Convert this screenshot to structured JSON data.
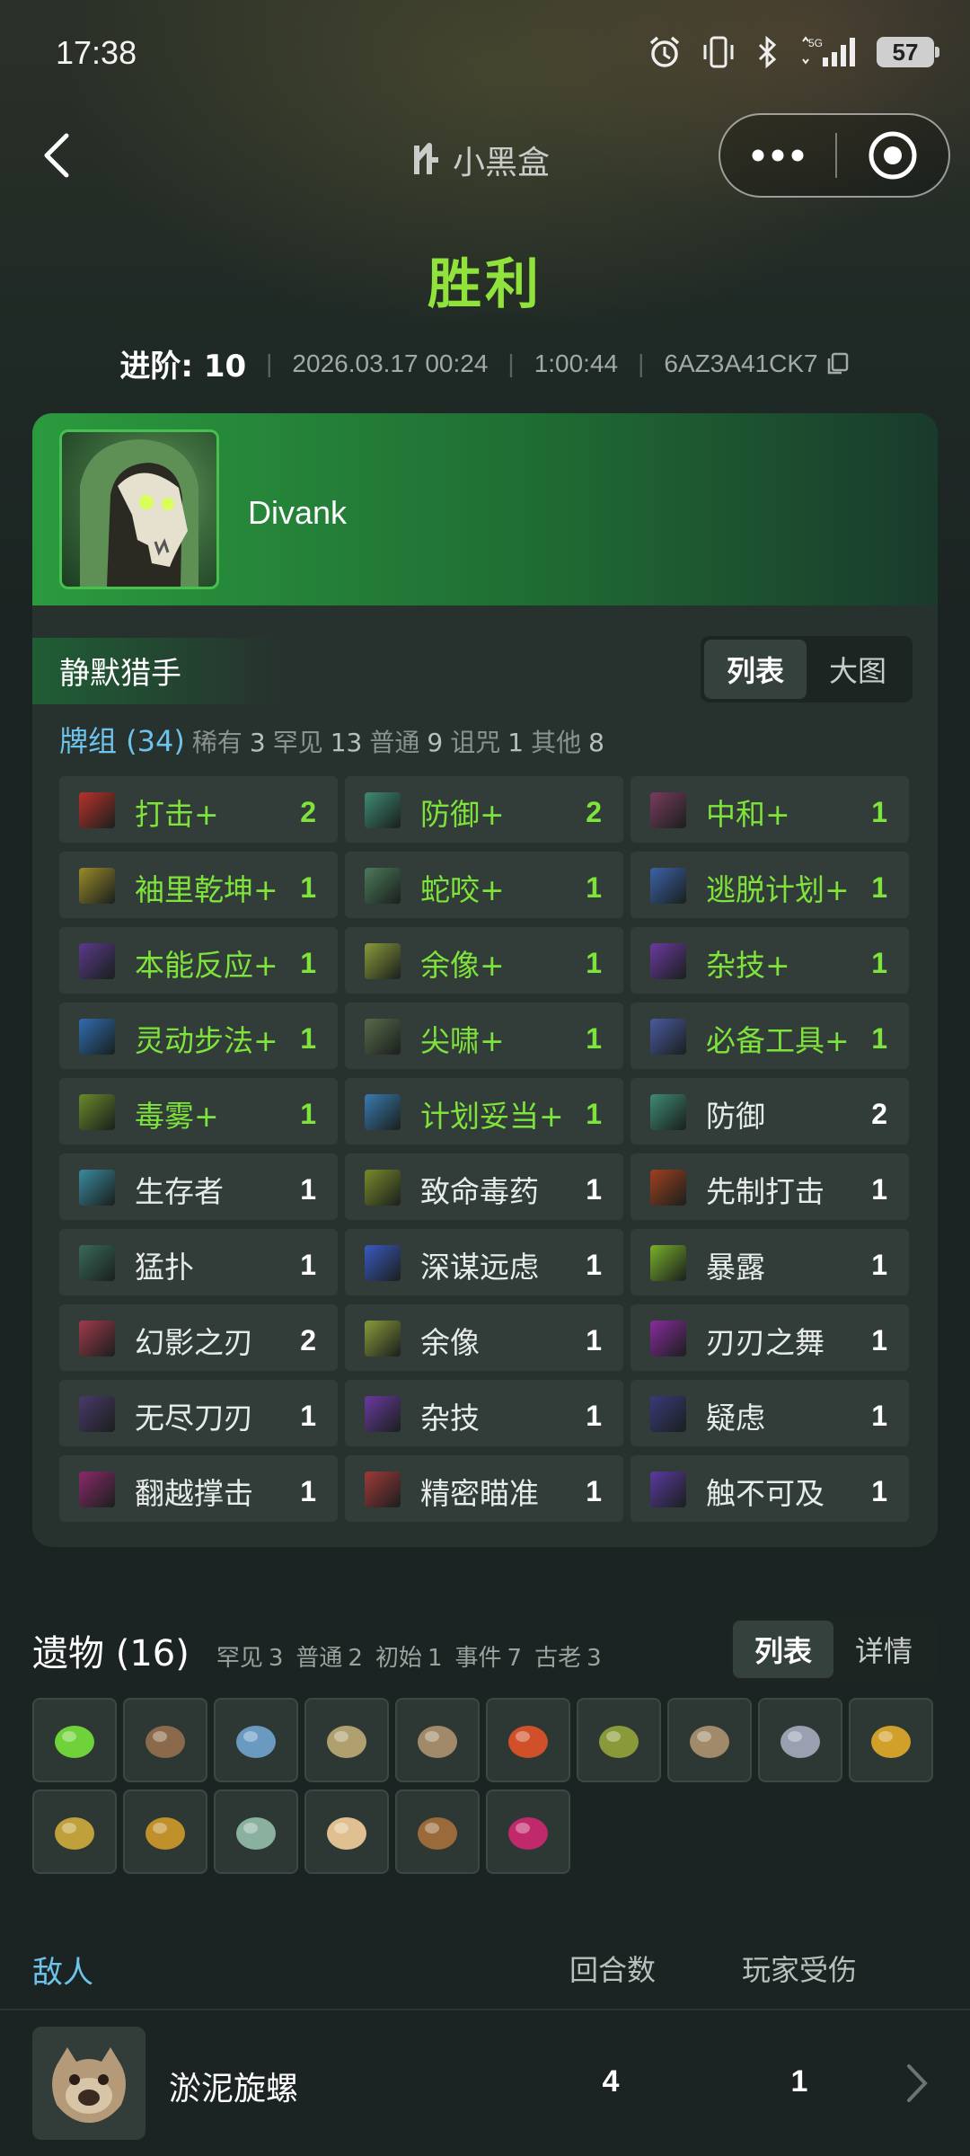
{
  "status_bar": {
    "time": "17:38",
    "battery": "57",
    "network": "5G"
  },
  "nav": {
    "brand": "小黑盒"
  },
  "result": {
    "title": "胜利",
    "ascension": "进阶: 10",
    "datetime": "2026.03.17 00:24",
    "duration": "1:00:44",
    "seed": "6AZ3A41CK7"
  },
  "character": {
    "name": "Divank",
    "class_name": "静默猎手"
  },
  "deck": {
    "view_toggle": [
      "列表",
      "大图"
    ],
    "summary": {
      "label": "牌组 (34)",
      "rare_label": "稀有",
      "rare": "3",
      "uncommon_label": "罕见",
      "uncommon": "13",
      "common_label": "普通",
      "common": "9",
      "curse_label": "诅咒",
      "curse": "1",
      "other_label": "其他",
      "other": "8"
    },
    "cards": [
      {
        "name": "打击+",
        "count": "2",
        "upgraded": true,
        "color": "#b8322a"
      },
      {
        "name": "防御+",
        "count": "2",
        "upgraded": true,
        "color": "#3f8a74"
      },
      {
        "name": "中和+",
        "count": "1",
        "upgraded": true,
        "color": "#7a3b5d"
      },
      {
        "name": "袖里乾坤+",
        "count": "1",
        "upgraded": true,
        "color": "#9a8a2a"
      },
      {
        "name": "蛇咬+",
        "count": "1",
        "upgraded": true,
        "color": "#4d7a5a"
      },
      {
        "name": "逃脱计划+",
        "count": "1",
        "upgraded": true,
        "color": "#3b62a8"
      },
      {
        "name": "本能反应+",
        "count": "1",
        "upgraded": true,
        "color": "#5a3a8a"
      },
      {
        "name": "余像+",
        "count": "1",
        "upgraded": true,
        "color": "#8a9a3a"
      },
      {
        "name": "杂技+",
        "count": "1",
        "upgraded": true,
        "color": "#6a3aa0"
      },
      {
        "name": "灵动步法+",
        "count": "1",
        "upgraded": true,
        "color": "#2f6db0"
      },
      {
        "name": "尖啸+",
        "count": "1",
        "upgraded": true,
        "color": "#5a6a4a"
      },
      {
        "name": "必备工具+",
        "count": "1",
        "upgraded": true,
        "color": "#4a5aa0"
      },
      {
        "name": "毒雾+",
        "count": "1",
        "upgraded": true,
        "color": "#6a8a2a"
      },
      {
        "name": "计划妥当+",
        "count": "1",
        "upgraded": true,
        "color": "#3a7ab0"
      },
      {
        "name": "防御",
        "count": "2",
        "upgraded": false,
        "color": "#3f8a74"
      },
      {
        "name": "生存者",
        "count": "1",
        "upgraded": false,
        "color": "#3a8aa0"
      },
      {
        "name": "致命毒药",
        "count": "1",
        "upgraded": false,
        "color": "#7a8a2a"
      },
      {
        "name": "先制打击",
        "count": "1",
        "upgraded": false,
        "color": "#a0401f"
      },
      {
        "name": "猛扑",
        "count": "1",
        "upgraded": false,
        "color": "#3a6a5a"
      },
      {
        "name": "深谋远虑",
        "count": "1",
        "upgraded": false,
        "color": "#3a5ac0"
      },
      {
        "name": "暴露",
        "count": "1",
        "upgraded": false,
        "color": "#7ab02a"
      },
      {
        "name": "幻影之刃",
        "count": "2",
        "upgraded": false,
        "color": "#a03a4a"
      },
      {
        "name": "余像",
        "count": "1",
        "upgraded": false,
        "color": "#8a9a3a"
      },
      {
        "name": "刃刃之舞",
        "count": "1",
        "upgraded": false,
        "color": "#8a2aa0"
      },
      {
        "name": "无尽刀刃",
        "count": "1",
        "upgraded": false,
        "color": "#4a3a6a"
      },
      {
        "name": "杂技",
        "count": "1",
        "upgraded": false,
        "color": "#6a3aa0"
      },
      {
        "name": "疑虑",
        "count": "1",
        "upgraded": false,
        "color": "#3a3a7a"
      },
      {
        "name": "翻越撑击",
        "count": "1",
        "upgraded": false,
        "color": "#8a2a6a"
      },
      {
        "name": "精密瞄准",
        "count": "1",
        "upgraded": false,
        "color": "#a03a3a"
      },
      {
        "name": "触不可及",
        "count": "1",
        "upgraded": false,
        "color": "#5a3aa0"
      }
    ]
  },
  "relics": {
    "title": "遗物 (16)",
    "summary": [
      {
        "label": "罕见",
        "value": "3"
      },
      {
        "label": "普通",
        "value": "2"
      },
      {
        "label": "初始",
        "value": "1"
      },
      {
        "label": "事件",
        "value": "7"
      },
      {
        "label": "古老",
        "value": "3"
      }
    ],
    "view_toggle": [
      "列表",
      "详情"
    ],
    "items": [
      {
        "icon": "eye-ring-icon",
        "color": "#6fd23a"
      },
      {
        "icon": "bundle-icon",
        "color": "#8a6a4a"
      },
      {
        "icon": "scroll-icon",
        "color": "#6a9ac0"
      },
      {
        "icon": "map-icon",
        "color": "#b0a070"
      },
      {
        "icon": "castle-icon",
        "color": "#a08a6a"
      },
      {
        "icon": "brazier-icon",
        "color": "#d0502a"
      },
      {
        "icon": "hat-icon",
        "color": "#8a9a3a"
      },
      {
        "icon": "turtle-icon",
        "color": "#a08a6a"
      },
      {
        "icon": "trident-icon",
        "color": "#9aa0b0"
      },
      {
        "icon": "flower-pot-icon",
        "color": "#d0a02a"
      },
      {
        "icon": "mango-icon",
        "color": "#c0a03a"
      },
      {
        "icon": "totem-icon",
        "color": "#c0902a"
      },
      {
        "icon": "teapot-icon",
        "color": "#8ab0a0"
      },
      {
        "icon": "cream-puff-icon",
        "color": "#e0c090"
      },
      {
        "icon": "whetstone-icon",
        "color": "#9a6a3a"
      },
      {
        "icon": "potion-icon",
        "color": "#c02a6a"
      }
    ]
  },
  "enemies": {
    "label": "敌人",
    "rounds_header": "回合数",
    "damage_header": "玩家受伤",
    "rows": [
      {
        "name": "淤泥旋螺",
        "rounds": "4",
        "damage": "1"
      }
    ]
  }
}
